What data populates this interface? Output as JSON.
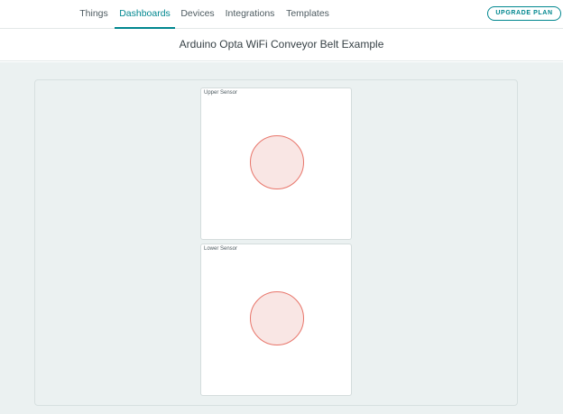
{
  "nav": {
    "tabs": [
      {
        "label": "Things",
        "active": false
      },
      {
        "label": "Dashboards",
        "active": true
      },
      {
        "label": "Devices",
        "active": false
      },
      {
        "label": "Integrations",
        "active": false
      },
      {
        "label": "Templates",
        "active": false
      }
    ],
    "upgrade_label": "UPGRADE PLAN"
  },
  "dashboard": {
    "title": "Arduino Opta WiFi Conveyor Belt Example",
    "widgets": [
      {
        "label": "Upper Sensor",
        "type": "status-led",
        "state": "off"
      },
      {
        "label": "Lower Sensor",
        "type": "status-led",
        "state": "off"
      }
    ]
  },
  "colors": {
    "accent": "#00878f",
    "led_fill": "#f9e6e4",
    "led_border": "#e8756a",
    "canvas_bg": "#ebf1f1"
  }
}
